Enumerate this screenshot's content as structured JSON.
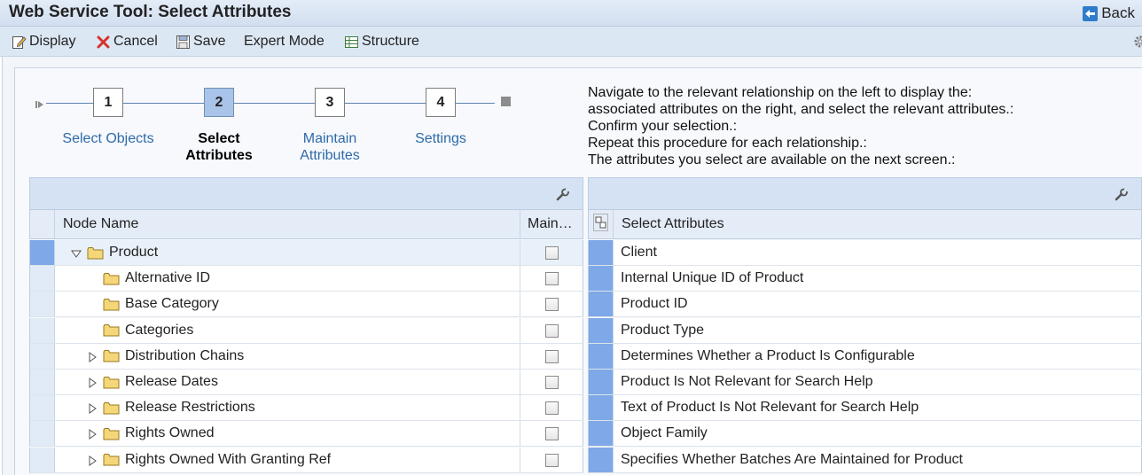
{
  "window": {
    "title": "Web Service Tool: Select Attributes",
    "back_label": "Back"
  },
  "toolbar": {
    "display_label": "Display",
    "cancel_label": "Cancel",
    "save_label": "Save",
    "expert_mode_label": "Expert Mode",
    "structure_label": "Structure"
  },
  "roadmap": {
    "steps": [
      {
        "number": "1",
        "label_line1": "Select Objects",
        "label_line2": ""
      },
      {
        "number": "2",
        "label_line1": "Select",
        "label_line2": "Attributes"
      },
      {
        "number": "3",
        "label_line1": "Maintain",
        "label_line2": "Attributes"
      },
      {
        "number": "4",
        "label_line1": "Settings",
        "label_line2": ""
      }
    ],
    "active_step": 2
  },
  "instructions": [
    "Navigate to the relevant relationship on the left to display the:",
    "associated attributes on the right, and select the relevant attributes.:",
    "Confirm your selection.:",
    "Repeat this procedure for each relationship.:",
    "The attributes you select are available on the next screen.:"
  ],
  "node_table": {
    "col_node_name": "Node Name",
    "col_maintain": "Main…",
    "rows": [
      {
        "name": "Product",
        "expander": "expanded",
        "selected": true
      },
      {
        "name": "Alternative ID",
        "expander": "none",
        "selected": false
      },
      {
        "name": "Base Category",
        "expander": "none",
        "selected": false
      },
      {
        "name": "Categories",
        "expander": "none",
        "selected": false
      },
      {
        "name": "Distribution Chains",
        "expander": "collapsed",
        "selected": false
      },
      {
        "name": "Release Dates",
        "expander": "collapsed",
        "selected": false
      },
      {
        "name": "Release Restrictions",
        "expander": "collapsed",
        "selected": false
      },
      {
        "name": "Rights Owned",
        "expander": "collapsed",
        "selected": false
      },
      {
        "name": "Rights Owned With Granting Ref",
        "expander": "collapsed",
        "selected": false
      }
    ]
  },
  "attribute_table": {
    "col_select_attributes": "Select Attributes",
    "rows": [
      {
        "name": "Client",
        "selected": true
      },
      {
        "name": "Internal Unique ID of Product",
        "selected": true
      },
      {
        "name": "Product ID",
        "selected": true
      },
      {
        "name": "Product Type",
        "selected": true
      },
      {
        "name": "Determines Whether a Product Is Configurable",
        "selected": true
      },
      {
        "name": "Product Is Not Relevant for Search Help",
        "selected": true
      },
      {
        "name": "Text of Product Is Not Relevant for Search Help",
        "selected": true
      },
      {
        "name": "Object Family",
        "selected": true
      },
      {
        "name": "Specifies Whether Batches Are Maintained for Product",
        "selected": true
      }
    ]
  },
  "colors": {
    "accent_blue": "#2e6aa8",
    "selection_blue": "#7ea8e8",
    "header_bg": "#d4e2f4"
  },
  "icons": {
    "back": "back-arrow-icon",
    "display": "display-pencil-icon",
    "cancel": "cancel-x-icon",
    "save": "save-disk-icon",
    "structure": "structure-icon",
    "settings": "gear-icon",
    "table_settings": "wrench-icon",
    "folder": "folder-icon"
  }
}
